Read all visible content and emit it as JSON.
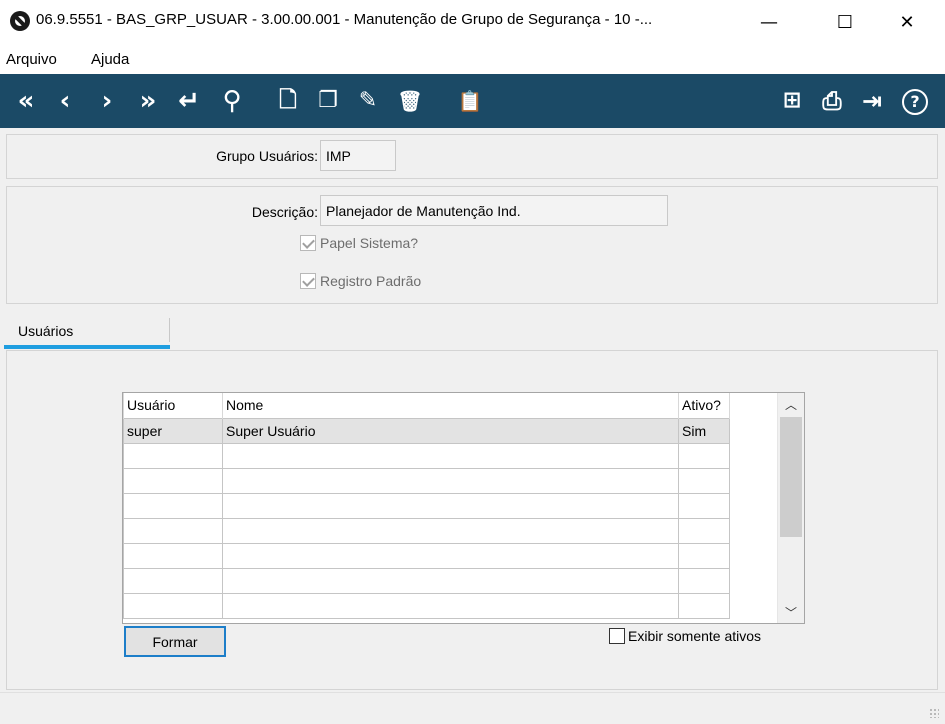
{
  "window": {
    "title": "06.9.5551 - BAS_GRP_USUAR - 3.00.00.001 - Manutenção de Grupo de Segurança - 10 -...",
    "minimize": "—",
    "maximize": "☐",
    "close": "✕"
  },
  "menu": {
    "items": [
      "Arquivo",
      "Ajuda"
    ]
  },
  "toolbar": {
    "left": [
      {
        "name": "first-record-icon",
        "glyph": "«"
      },
      {
        "name": "previous-record-icon",
        "glyph": "‹"
      },
      {
        "name": "next-record-icon",
        "glyph": "›"
      },
      {
        "name": "last-record-icon",
        "glyph": "»"
      },
      {
        "name": "goto-icon",
        "glyph": "↵"
      },
      {
        "name": "search-icon",
        "glyph": "⚲"
      },
      {
        "name": "new-record-icon",
        "glyph": "🗋"
      },
      {
        "name": "copy-record-icon",
        "glyph": "❐"
      },
      {
        "name": "edit-record-icon",
        "glyph": "✎"
      },
      {
        "name": "delete-record-icon",
        "glyph": "🗑"
      },
      {
        "name": "paste-record-icon",
        "glyph": "📋"
      }
    ],
    "right": [
      {
        "name": "tree-view-icon",
        "glyph": "⊞"
      },
      {
        "name": "print-icon",
        "glyph": "⎙"
      },
      {
        "name": "exit-icon",
        "glyph": "⇥"
      },
      {
        "name": "help-icon",
        "glyph": "?"
      }
    ]
  },
  "form": {
    "grupo_label": "Grupo Usuários:",
    "grupo_value": "IMP",
    "descricao_label": "Descrição:",
    "descricao_value": "Planejador de Manutenção Ind.",
    "papel_sistema_label": "Papel Sistema?",
    "papel_sistema_checked": true,
    "registro_padrao_label": "Registro Padrão",
    "registro_padrao_checked": true
  },
  "tabs": [
    {
      "label": "Usuários",
      "active": true
    }
  ],
  "grid": {
    "columns": [
      "Usuário",
      "Nome",
      "Ativo?"
    ],
    "rows": [
      [
        "super",
        "Super Usuário",
        "Sim"
      ],
      [
        "",
        "",
        ""
      ],
      [
        "",
        "",
        ""
      ],
      [
        "",
        "",
        ""
      ],
      [
        "",
        "",
        ""
      ],
      [
        "",
        "",
        ""
      ],
      [
        "",
        "",
        ""
      ],
      [
        "",
        "",
        ""
      ]
    ]
  },
  "actions": {
    "formar_label": "Formar",
    "exibir_ativos_label": "Exibir somente ativos",
    "exibir_ativos_checked": false
  }
}
